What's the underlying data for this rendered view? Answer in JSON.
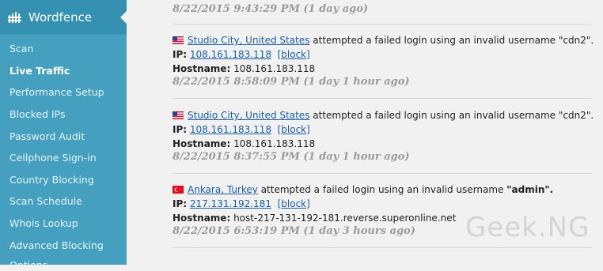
{
  "sidebar": {
    "title": "Wordfence",
    "items": [
      {
        "label": "Scan"
      },
      {
        "label": "Live Traffic",
        "active": true
      },
      {
        "label": "Performance Setup"
      },
      {
        "label": "Blocked IPs"
      },
      {
        "label": "Password Audit"
      },
      {
        "label": "Cellphone Sign-in"
      },
      {
        "label": "Country Blocking"
      },
      {
        "label": "Scan Schedule"
      },
      {
        "label": "Whois Lookup"
      },
      {
        "label": "Advanced Blocking"
      },
      {
        "label": "Options"
      }
    ]
  },
  "entries": [
    {
      "timestamp": "8/22/2015 9:43:29 PM (1 day ago)"
    },
    {
      "flag": "us-flag-icon",
      "location": "Studio City, United States",
      "message": "attempted a failed login using an invalid username",
      "username": "\"cdn2\".",
      "ip_label": "IP:",
      "ip": "108.161.183.118",
      "block_label": "[block]",
      "hostname_label": "Hostname:",
      "hostname": "108.161.183.118",
      "timestamp": "8/22/2015 8:58:09 PM (1 day 1 hour ago)"
    },
    {
      "flag": "us-flag-icon",
      "location": "Studio City, United States",
      "message": "attempted a failed login using an invalid username",
      "username": "\"cdn2\".",
      "ip_label": "IP:",
      "ip": "108.161.183.118",
      "block_label": "[block]",
      "hostname_label": "Hostname:",
      "hostname": "108.161.183.118",
      "timestamp": "8/22/2015 8:37:55 PM (1 day 1 hour ago)"
    },
    {
      "flag": "tr-flag-icon",
      "location": "Ankara, Turkey",
      "message": "attempted a failed login using an invalid username",
      "username": "\"admin\".",
      "ip_label": "IP:",
      "ip": "217.131.192.181",
      "block_label": "[block]",
      "hostname_label": "Hostname:",
      "hostname": "host-217-131-192-181.reverse.superonline.net",
      "timestamp": "8/22/2015 6:53:19 PM (1 day 3 hours ago)"
    }
  ],
  "watermark": "Geek.NG",
  "colors": {
    "sidebar": "#45a0c0",
    "sidebar_header": "#3491b2",
    "link": "#1a5ea8",
    "timestamp": "#9a9a9a"
  }
}
